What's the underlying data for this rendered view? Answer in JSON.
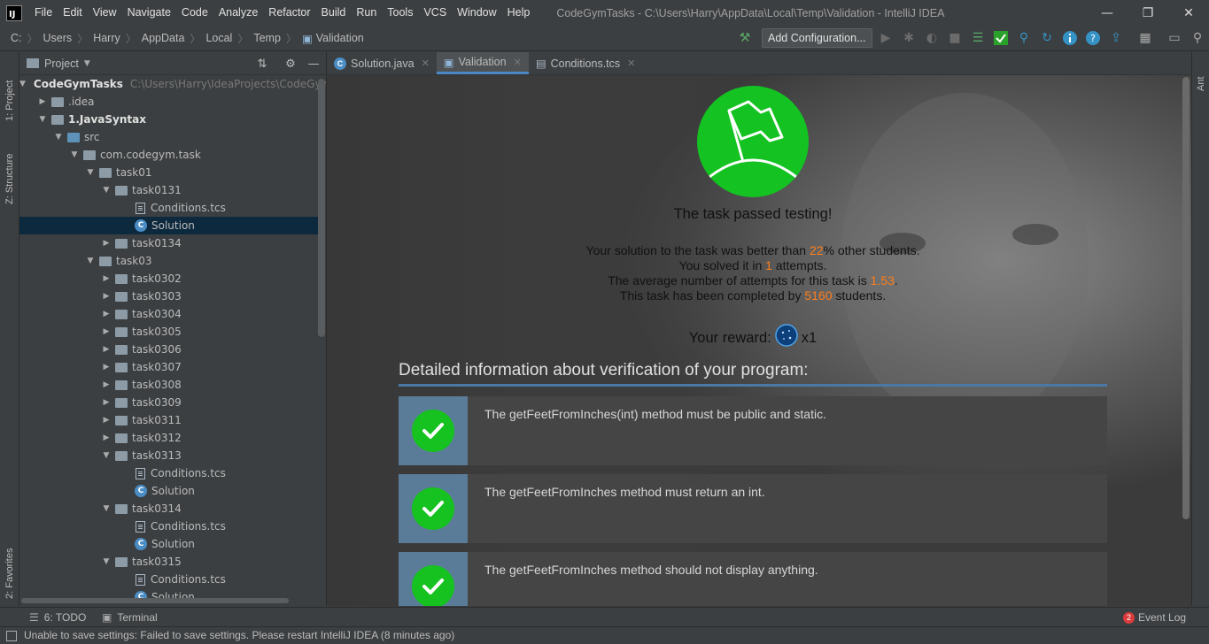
{
  "app": {
    "logo_text": "IJ",
    "menu": [
      "File",
      "Edit",
      "View",
      "Navigate",
      "Code",
      "Analyze",
      "Refactor",
      "Build",
      "Run",
      "Tools",
      "VCS",
      "Window",
      "Help"
    ],
    "window_title": "CodeGymTasks - C:\\Users\\Harry\\AppData\\Local\\Temp\\Validation - IntelliJ IDEA",
    "controls": {
      "minimize": "—",
      "restore": "❐",
      "close": "✕"
    }
  },
  "navbar": {
    "breadcrumbs": [
      "C:",
      "Users",
      "Harry",
      "AppData",
      "Local",
      "Temp",
      "Validation"
    ],
    "add_config": "Add Configuration..."
  },
  "left_strip": {
    "project_tab": "1: Project",
    "structure_tab": "Z: Structure",
    "favorites_tab": "2: Favorites"
  },
  "right_strip": {
    "ant_tab": "Ant"
  },
  "project": {
    "title": "Project",
    "tree": [
      {
        "label": "CodeGymTasks",
        "hint": "C:\\Users\\Harry\\IdeaProjects\\CodeGymTasks"
      },
      {
        "label": ".idea"
      },
      {
        "label": "1.JavaSyntax"
      },
      {
        "label": "src"
      },
      {
        "label": "com.codegym.task"
      },
      {
        "label": "task01"
      },
      {
        "label": "task0131"
      },
      {
        "label": "Conditions.tcs"
      },
      {
        "label": "Solution"
      },
      {
        "label": "task0134"
      },
      {
        "label": "task03"
      },
      {
        "label": "task0302"
      },
      {
        "label": "task0303"
      },
      {
        "label": "task0304"
      },
      {
        "label": "task0305"
      },
      {
        "label": "task0306"
      },
      {
        "label": "task0307"
      },
      {
        "label": "task0308"
      },
      {
        "label": "task0309"
      },
      {
        "label": "task0311"
      },
      {
        "label": "task0312"
      },
      {
        "label": "task0313"
      },
      {
        "label": "Conditions.tcs"
      },
      {
        "label": "Solution"
      },
      {
        "label": "task0314"
      },
      {
        "label": "Conditions.tcs"
      },
      {
        "label": "Solution"
      },
      {
        "label": "task0315"
      },
      {
        "label": "Conditions.tcs"
      },
      {
        "label": "Solution"
      }
    ]
  },
  "tabs": [
    {
      "label": "Solution.java",
      "active": false
    },
    {
      "label": "Validation",
      "active": true
    },
    {
      "label": "Conditions.tcs",
      "active": false
    }
  ],
  "validation": {
    "title": "The task passed testing!",
    "stats": {
      "better_pre": "Your solution to the task was better than ",
      "better_val": "22",
      "better_post": "% other students.",
      "solved_pre": "You solved it in ",
      "solved_val": "1",
      "solved_post": " attempts.",
      "avg_pre": "The average number of attempts for this task is ",
      "avg_val": "1.53",
      "avg_post": ".",
      "completed_pre": "This task has been completed by ",
      "completed_val": "5160",
      "completed_post": " students."
    },
    "reward_label": "Your reward:",
    "reward_count": "x1",
    "detail_title": "Detailed information about verification of your program:",
    "checks": [
      "The getFeetFromInches(int) method must be public and static.",
      "The getFeetFromInches method must return an int.",
      "The getFeetFromInches method should not display anything."
    ]
  },
  "bottom": {
    "todo": "6: TODO",
    "terminal": "Terminal",
    "event_count": "2",
    "event_log": "Event Log"
  },
  "status": "Unable to save settings: Failed to save settings. Please restart IntelliJ IDEA (8 minutes ago)",
  "colors": {
    "accent": "#4a88c7",
    "success": "#16c21f",
    "highlight": "#ff7e1a",
    "selection": "#0d293e"
  }
}
